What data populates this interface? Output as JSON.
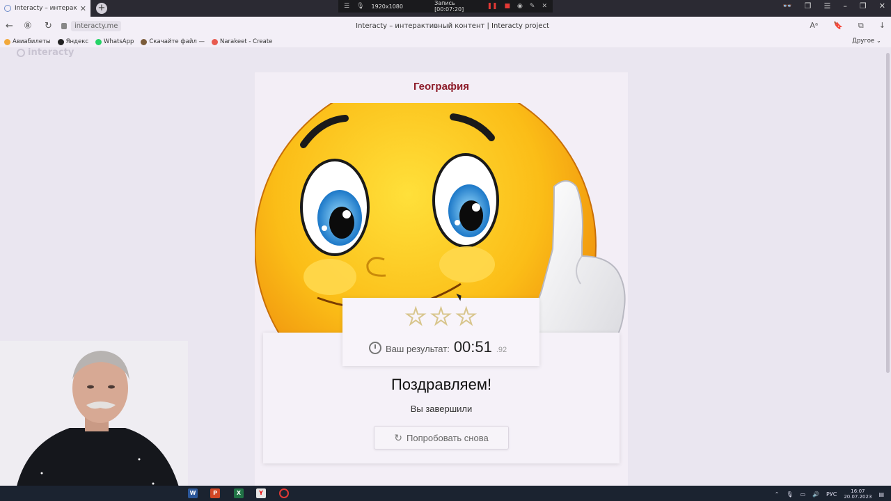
{
  "browser": {
    "tab_title": "Interacty – интерактив",
    "url": "interacty.me",
    "page_title": "Interacty – интерактивный контент | Interacty project",
    "recording": {
      "resolution": "1920x1080",
      "status": "Запись [00:07:20]"
    },
    "bookmarks": [
      {
        "label": "Авиабилеты",
        "color": "#f2a93b"
      },
      {
        "label": "Яндекс",
        "color": "#222222"
      },
      {
        "label": "WhatsApp",
        "color": "#25d366"
      },
      {
        "label": "Скачайте файл —",
        "color": "#7b5c3a"
      },
      {
        "label": "Narakeet - Create",
        "color": "#e85a4f"
      }
    ],
    "bookmarks_other": "Другое"
  },
  "page": {
    "logo_text": "interacty",
    "quiz_title": "География",
    "stars_total": 3,
    "stars_filled": 0,
    "result_label": "Ваш результат:",
    "result_time": "00:51",
    "result_ms": ".92",
    "congrats": "Поздравляем!",
    "completed": "Вы завершили",
    "retry_label": "Попробовать снова"
  },
  "taskbar": {
    "lang": "РУС",
    "time": "16:07",
    "date": "20.07.2023"
  },
  "colors": {
    "title_red": "#8d1c2a",
    "page_bg": "#eae6f0",
    "card_bg": "#f3eef6"
  }
}
